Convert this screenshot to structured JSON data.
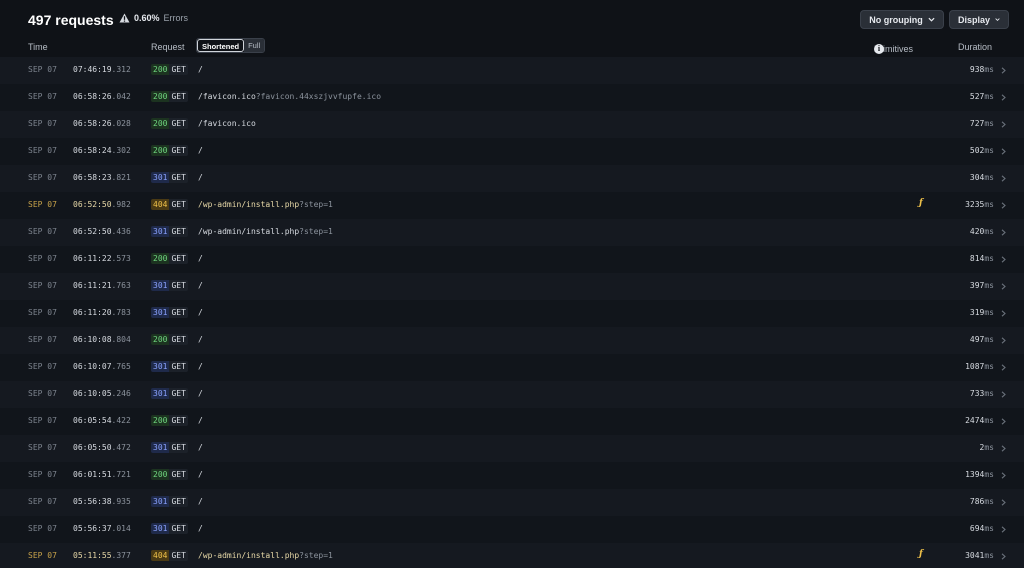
{
  "header": {
    "request_count": "497 requests",
    "error_pct": "0.60%",
    "error_label": "Errors",
    "grouping_label": "No grouping",
    "display_label": "Display"
  },
  "columns": {
    "time": "Time",
    "request": "Request",
    "toggle_on": "Shortened",
    "toggle_off": "Full",
    "primitives": "Primitives",
    "primitives_info": "i",
    "duration": "Duration"
  },
  "colors": {
    "status_200": "#6fd67f",
    "status_301": "#8aa2ff",
    "status_404": "#f0c24a",
    "background": "#0f1217"
  },
  "rows": [
    {
      "date": "SEP 07",
      "time": "07:46:19",
      "ms": ".312",
      "status": "200",
      "method": "GET",
      "path": "/",
      "query": "",
      "primitive": "",
      "duration": "938",
      "unit": "ms"
    },
    {
      "date": "SEP 07",
      "time": "06:58:26",
      "ms": ".042",
      "status": "200",
      "method": "GET",
      "path": "/favicon.ico",
      "query": "?favicon.44xszjvvfupfe.ico",
      "primitive": "",
      "duration": "527",
      "unit": "ms"
    },
    {
      "date": "SEP 07",
      "time": "06:58:26",
      "ms": ".028",
      "status": "200",
      "method": "GET",
      "path": "/favicon.ico",
      "query": "",
      "primitive": "",
      "duration": "727",
      "unit": "ms"
    },
    {
      "date": "SEP 07",
      "time": "06:58:24",
      "ms": ".302",
      "status": "200",
      "method": "GET",
      "path": "/",
      "query": "",
      "primitive": "",
      "duration": "502",
      "unit": "ms"
    },
    {
      "date": "SEP 07",
      "time": "06:58:23",
      "ms": ".821",
      "status": "301",
      "method": "GET",
      "path": "/",
      "query": "",
      "primitive": "",
      "duration": "304",
      "unit": "ms"
    },
    {
      "date": "SEP 07",
      "time": "06:52:50",
      "ms": ".982",
      "status": "404",
      "method": "GET",
      "path": "/wp-admin/install.php",
      "query": "?step=1",
      "primitive": "ƒ",
      "duration": "3235",
      "unit": "ms"
    },
    {
      "date": "SEP 07",
      "time": "06:52:50",
      "ms": ".436",
      "status": "301",
      "method": "GET",
      "path": "/wp-admin/install.php",
      "query": "?step=1",
      "primitive": "",
      "duration": "420",
      "unit": "ms"
    },
    {
      "date": "SEP 07",
      "time": "06:11:22",
      "ms": ".573",
      "status": "200",
      "method": "GET",
      "path": "/",
      "query": "",
      "primitive": "",
      "duration": "814",
      "unit": "ms"
    },
    {
      "date": "SEP 07",
      "time": "06:11:21",
      "ms": ".763",
      "status": "301",
      "method": "GET",
      "path": "/",
      "query": "",
      "primitive": "",
      "duration": "397",
      "unit": "ms"
    },
    {
      "date": "SEP 07",
      "time": "06:11:20",
      "ms": ".783",
      "status": "301",
      "method": "GET",
      "path": "/",
      "query": "",
      "primitive": "",
      "duration": "319",
      "unit": "ms"
    },
    {
      "date": "SEP 07",
      "time": "06:10:08",
      "ms": ".804",
      "status": "200",
      "method": "GET",
      "path": "/",
      "query": "",
      "primitive": "",
      "duration": "497",
      "unit": "ms"
    },
    {
      "date": "SEP 07",
      "time": "06:10:07",
      "ms": ".765",
      "status": "301",
      "method": "GET",
      "path": "/",
      "query": "",
      "primitive": "",
      "duration": "1087",
      "unit": "ms"
    },
    {
      "date": "SEP 07",
      "time": "06:10:05",
      "ms": ".246",
      "status": "301",
      "method": "GET",
      "path": "/",
      "query": "",
      "primitive": "",
      "duration": "733",
      "unit": "ms"
    },
    {
      "date": "SEP 07",
      "time": "06:05:54",
      "ms": ".422",
      "status": "200",
      "method": "GET",
      "path": "/",
      "query": "",
      "primitive": "",
      "duration": "2474",
      "unit": "ms"
    },
    {
      "date": "SEP 07",
      "time": "06:05:50",
      "ms": ".472",
      "status": "301",
      "method": "GET",
      "path": "/",
      "query": "",
      "primitive": "",
      "duration": "2",
      "unit": "ms"
    },
    {
      "date": "SEP 07",
      "time": "06:01:51",
      "ms": ".721",
      "status": "200",
      "method": "GET",
      "path": "/",
      "query": "",
      "primitive": "",
      "duration": "1394",
      "unit": "ms"
    },
    {
      "date": "SEP 07",
      "time": "05:56:38",
      "ms": ".935",
      "status": "301",
      "method": "GET",
      "path": "/",
      "query": "",
      "primitive": "",
      "duration": "786",
      "unit": "ms"
    },
    {
      "date": "SEP 07",
      "time": "05:56:37",
      "ms": ".014",
      "status": "301",
      "method": "GET",
      "path": "/",
      "query": "",
      "primitive": "",
      "duration": "694",
      "unit": "ms"
    },
    {
      "date": "SEP 07",
      "time": "05:11:55",
      "ms": ".377",
      "status": "404",
      "method": "GET",
      "path": "/wp-admin/install.php",
      "query": "?step=1",
      "primitive": "ƒ",
      "duration": "3041",
      "unit": "ms"
    }
  ]
}
